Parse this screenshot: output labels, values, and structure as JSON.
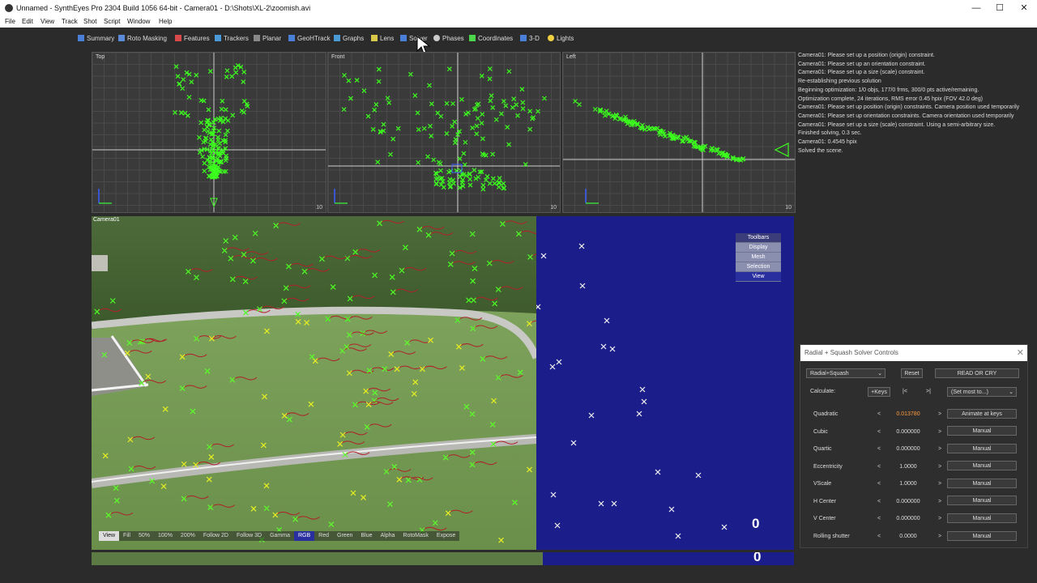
{
  "window": {
    "title": "Unnamed - SynthEyes Pro 2304 Build 1056 64-bit - Camera01 - D:\\Shots\\XL-2\\zoomish.avi",
    "minimize": "—",
    "maximize": "☐",
    "close": "✕"
  },
  "menu": [
    "File",
    "Edit",
    "View",
    "Track",
    "Shot",
    "Script",
    "Window",
    "Help"
  ],
  "tabs": [
    {
      "label": "Summary",
      "icon": "summary-icon",
      "color": "#4a7fd8"
    },
    {
      "label": "Roto Masking",
      "icon": "roto-icon",
      "color": "#5a8ad8"
    },
    {
      "label": "Features",
      "icon": "features-icon",
      "color": "#d84a4a"
    },
    {
      "label": "Trackers",
      "icon": "trackers-icon",
      "color": "#4a9ad8"
    },
    {
      "label": "Planar",
      "icon": "planar-icon",
      "color": "#888888"
    },
    {
      "label": "GeoHTrack",
      "icon": "geohtrack-icon",
      "color": "#4a7fd8"
    },
    {
      "label": "Graphs",
      "icon": "graphs-icon",
      "color": "#4a9ad8"
    },
    {
      "label": "Lens",
      "icon": "lens-icon",
      "color": "#d8c84a"
    },
    {
      "label": "Solver",
      "icon": "solver-icon",
      "color": "#4a7fd8"
    },
    {
      "label": "Phases",
      "icon": "phases-icon",
      "color": "#cccccc"
    },
    {
      "label": "Coordinates",
      "icon": "coordinates-icon",
      "color": "#4ad84a"
    },
    {
      "label": "3-D",
      "icon": "3d-icon",
      "color": "#4a7fd8"
    },
    {
      "label": "Lights",
      "icon": "lights-icon",
      "color": "#f0d040"
    }
  ],
  "viewports": {
    "top": {
      "label": "Top",
      "corner": "10"
    },
    "front": {
      "label": "Front",
      "corner": "10"
    },
    "left": {
      "label": "Left",
      "corner": "10"
    }
  },
  "log": [
    "Camera01: Please set up a position (origin) constraint.",
    "Camera01: Please set up an orientation constraint.",
    "Camera01: Please set up a size (scale) constraint.",
    "Re-establishing previous solution",
    "Beginning optimization: 1/0 objs, 177/0 frms, 300/0 pts active/remaining.",
    "Optimization complete, 24 iterations, RMS error 0.45 hpix (FOV 42.0 deg)",
    "Camera01: Please set up position (origin) constraints. Camera position used temporarily",
    "Camera01: Please set up orientation constraints. Camera orientation used temporarily",
    "Camera01: Please set up a size (scale) constraint. Using a semi-arbitrary size.",
    "Finished solving, 0.3 sec.",
    "Camera01: 0.4545 hpix",
    "Solved the scene."
  ],
  "camera_view": {
    "label": "Camera01",
    "frame_number": "0"
  },
  "viewbar": [
    "View",
    "Fill",
    "50%",
    "100%",
    "200%",
    "Follow 2D",
    "Follow 3D",
    "Gamma",
    "RGB",
    "Red",
    "Green",
    "Blue",
    "Alpha",
    "RotoMask",
    "Expose"
  ],
  "viewbar_active": "RGB",
  "toolbox": {
    "header": "Toolbars",
    "items": [
      "Display",
      "Mesh",
      "Selection",
      "View"
    ],
    "active": "View"
  },
  "strip_frame_number": "0",
  "solver_panel": {
    "title": "Radial + Squash Solver Controls",
    "mode_select": "Radial+Squash",
    "reset_label": "Reset",
    "read_or_cry_label": "READ OR CRY",
    "calculate_label": "Calculate:",
    "keys_label": "+Keys",
    "first_key": "|<",
    "last_key": ">|",
    "set_most_select": "(Set most to...)",
    "rows": [
      {
        "label": "Quadratic",
        "value": "0.013780",
        "button": "Animate at keys",
        "highlight": true
      },
      {
        "label": "Cubic",
        "value": "0.000000",
        "button": "Manual",
        "highlight": false
      },
      {
        "label": "Quartic",
        "value": "0.000000",
        "button": "Manual",
        "highlight": false
      },
      {
        "label": "Eccentricity",
        "value": "1.0000",
        "button": "Manual",
        "highlight": false
      },
      {
        "label": "VScale",
        "value": "1.0000",
        "button": "Manual",
        "highlight": false
      },
      {
        "label": "H Center",
        "value": "0.000000",
        "button": "Manual",
        "highlight": false
      },
      {
        "label": "V Center",
        "value": "0.000000",
        "button": "Manual",
        "highlight": false
      },
      {
        "label": "Rolling shutter",
        "value": "0.0000",
        "button": "Manual",
        "highlight": false
      }
    ]
  }
}
